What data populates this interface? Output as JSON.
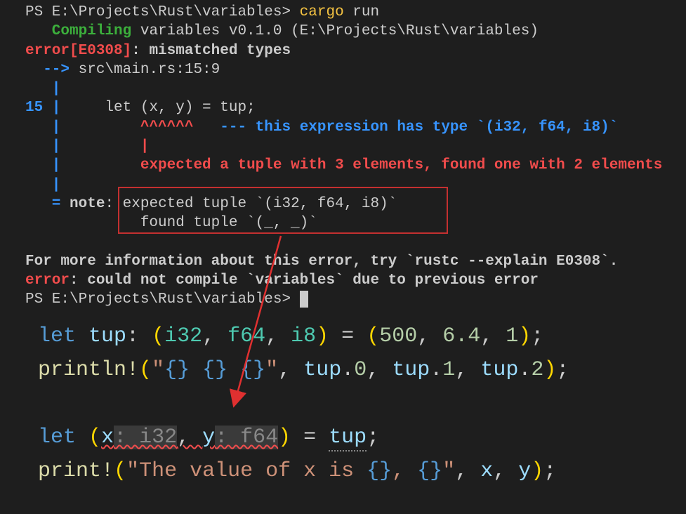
{
  "terminal": {
    "prompt1": "PS E:\\Projects\\Rust\\variables> ",
    "cargo": "cargo",
    "run": " run",
    "compiling_label": "   Compiling",
    "compiling_rest": " variables v0.1.0 (E:\\Projects\\Rust\\variables)",
    "error_code": "error[E0308]",
    "error_msg": ": mismatched types",
    "arrow": "  --> ",
    "location": "src\\main.rs:15:9",
    "pipe_only": "   |",
    "line_num": "15 ",
    "pipe": "|",
    "code_line": "     let (x, y) = tup;",
    "carets": "         ^^^^^^",
    "dashes": "   ---",
    "type_hint": " this expression has type `(i32, f64, i8)`",
    "pipe_inner": "         |",
    "expected_msg": "         expected a tuple with 3 elements, found one with 2 elements",
    "eq_note": "   = ",
    "note_label": "note",
    "note_colon": ": ",
    "expected_tuple": "expected tuple `(i32, f64, i8)`",
    "found_tuple": "             found tuple `(_, _)`",
    "blank": "",
    "more_info": "For more information about this error, try `rustc --explain E0308`.",
    "error2_label": "error",
    "error2_msg": ": could not compile `variables` due to previous error",
    "prompt2": "PS E:\\Projects\\Rust\\variables> "
  },
  "editor": {
    "line1": {
      "let": "let",
      "tup": " tup",
      "colon": ": ",
      "lp": "(",
      "i32": "i32",
      "c1": ", ",
      "f64": "f64",
      "c2": ", ",
      "i8": "i8",
      "rp": ")",
      "eq": " = ",
      "lp2": "(",
      "n500": "500",
      "c3": ", ",
      "n64": "6.4",
      "c4": ", ",
      "n1": "1",
      "rp2": ")",
      "semi": ";"
    },
    "line2": {
      "macro": "println!",
      "lp": "(",
      "q1": "\"",
      "b1": "{}",
      "sp1": " ",
      "b2": "{}",
      "sp2": " ",
      "b3": "{}",
      "q2": "\"",
      "c1": ", ",
      "tup0": "tup",
      "d0": ".",
      "i0": "0",
      "c2": ", ",
      "tup1": "tup",
      "d1": ".",
      "i1": "1",
      "c3": ", ",
      "tup2": "tup",
      "d2": ".",
      "i2": "2",
      "rp": ")",
      "semi": ";"
    },
    "line3": {
      "let": "let",
      "sp": " ",
      "lp": "(",
      "x": "x",
      "hint_x": ": i32",
      "c1": ", ",
      "y": "y",
      "hint_y": ": f64",
      "rp": ")",
      "eq": " = ",
      "tup": "tup",
      "semi": ";"
    },
    "line4": {
      "macro": "print!",
      "lp": "(",
      "q1": "\"",
      "str": "The value of x is ",
      "b1": "{}",
      "c0": ", ",
      "b2": "{}",
      "q2": "\"",
      "c1": ", ",
      "x": "x",
      "c2": ", ",
      "y": "y",
      "rp": ")",
      "semi": ";"
    }
  }
}
